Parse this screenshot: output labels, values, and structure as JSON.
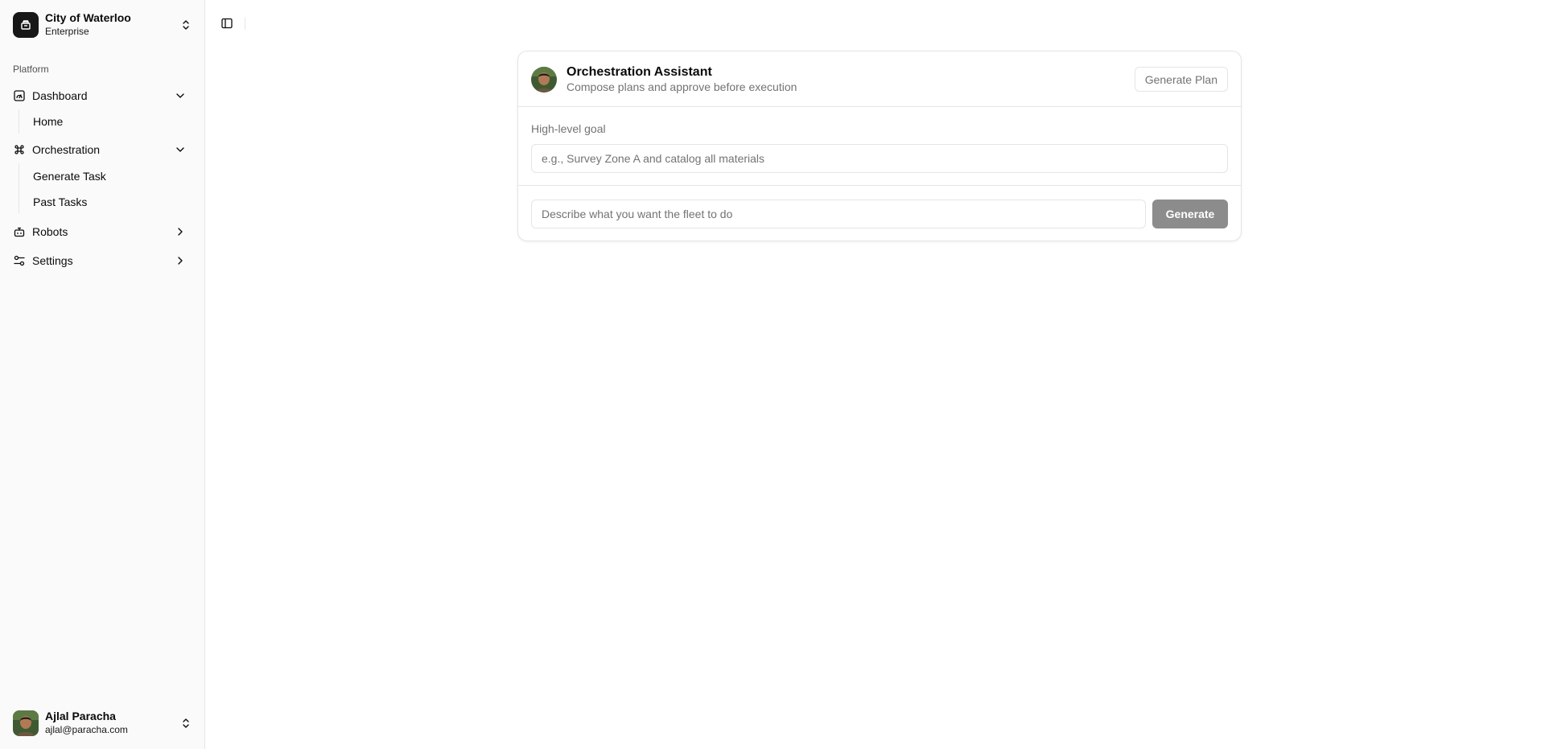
{
  "org": {
    "name": "City of Waterloo",
    "plan": "Enterprise"
  },
  "sidebar": {
    "group_label": "Platform",
    "dashboard": {
      "label": "Dashboard",
      "children": [
        "Home"
      ]
    },
    "orchestration": {
      "label": "Orchestration",
      "children": [
        "Generate Task",
        "Past Tasks"
      ]
    },
    "robots": {
      "label": "Robots"
    },
    "settings": {
      "label": "Settings"
    }
  },
  "user": {
    "name": "Ajlal Paracha",
    "email": "ajlal@paracha.com"
  },
  "assistant": {
    "title": "Orchestration Assistant",
    "subtitle": "Compose plans and approve before execution",
    "generate_plan_label": "Generate Plan",
    "goal_label": "High-level goal",
    "goal_placeholder": "e.g., Survey Zone A and catalog all materials",
    "prompt_placeholder": "Describe what you want the fleet to do",
    "generate_label": "Generate"
  },
  "colors": {
    "primary_disabled": "#8c8c8c",
    "border": "#e5e5e5",
    "sidebar_bg": "#fafafa",
    "logo_bg": "#171717"
  },
  "icons": {
    "org": "building-icon",
    "switcher": "chevrons-up-down-icon",
    "dashboard": "gauge-icon",
    "orchestration": "command-icon",
    "robots": "bot-icon",
    "settings": "sliders-icon",
    "sidebar_toggle": "panel-left-icon"
  }
}
